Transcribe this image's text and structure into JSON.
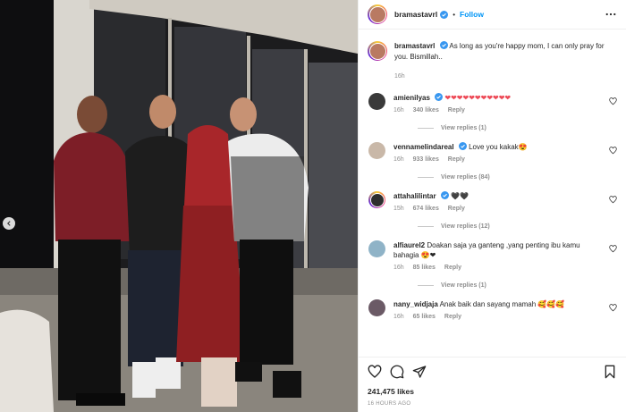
{
  "post": {
    "username": "bramastavrl",
    "follow_label": "Follow",
    "separator": "•",
    "caption_text": "As long as you're happy mom, I can only pray for you. Bismillah..",
    "caption_time": "16h",
    "likes": "241,475 likes",
    "posted": "16 HOURS AGO"
  },
  "comments": [
    {
      "username": "amienilyas",
      "text": "❤❤❤❤❤❤❤❤❤❤❤",
      "time": "16h",
      "likes": "340 likes",
      "reply": "Reply",
      "view_replies": "View replies (1)",
      "verified": true
    },
    {
      "username": "vennamelindareal",
      "text": "Love you kakak😍",
      "time": "16h",
      "likes": "933 likes",
      "reply": "Reply",
      "view_replies": "View replies (84)",
      "verified": true
    },
    {
      "username": "attahalilintar",
      "text": "🖤🖤",
      "time": "15h",
      "likes": "674 likes",
      "reply": "Reply",
      "view_replies": "View replies (12)",
      "verified": true
    },
    {
      "username": "alfiaurel2",
      "text": "Doakan saja ya ganteng ,yang penting ibu kamu bahagia 😍❤",
      "time": "16h",
      "likes": "85 likes",
      "reply": "Reply",
      "view_replies": "View replies (1)",
      "verified": false
    },
    {
      "username": "nany_widjaja",
      "text": "Anak baik dan sayang mamah 🥰🥰🥰",
      "time": "16h",
      "likes": "65 likes",
      "reply": "Reply",
      "view_replies": "",
      "verified": false
    }
  ],
  "icons": {
    "heart": "heart-icon",
    "comment": "comment-icon",
    "share": "share-icon",
    "save": "bookmark-icon",
    "prev": "chevron-left-icon",
    "more": "more-icon"
  },
  "colors": {
    "link": "#0095f6",
    "verified": "#3897f0",
    "muted": "#8e8e8e"
  }
}
